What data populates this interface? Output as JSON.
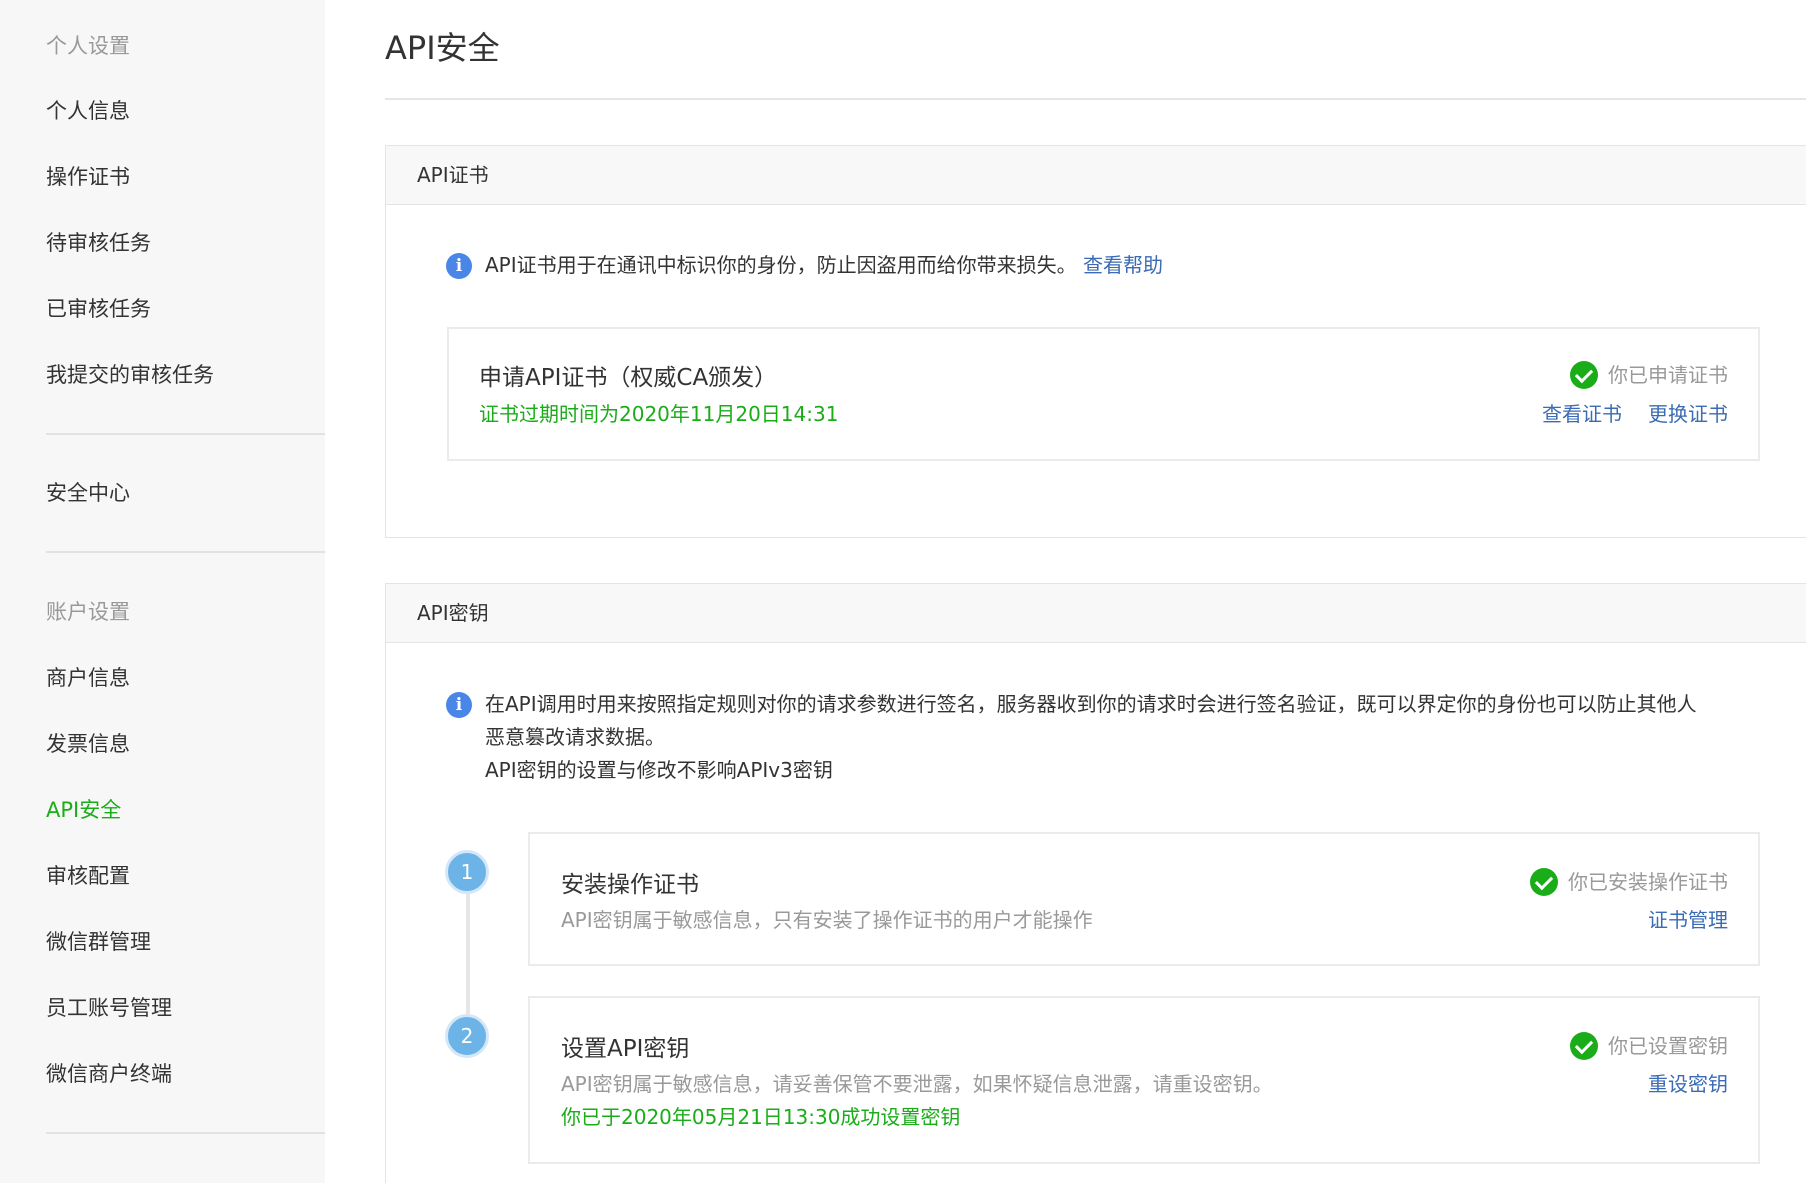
{
  "sidebar": {
    "section_personal": "个人设置",
    "items_personal": [
      "个人信息",
      "操作证书",
      "待审核任务",
      "已审核任务",
      "我提交的审核任务"
    ],
    "security_center": "安全中心",
    "section_account": "账户设置",
    "items_account": [
      "商户信息",
      "发票信息",
      "API安全",
      "审核配置",
      "微信群管理",
      "员工账号管理",
      "微信商户终端"
    ],
    "active_item": "API安全"
  },
  "page": {
    "title": "API安全"
  },
  "cert_panel": {
    "header": "API证书",
    "info": "API证书用于在通讯中标识你的身份，防止因盗用而给你带来损失。",
    "help_link": "查看帮助",
    "card": {
      "title": "申请API证书（权威CA颁发）",
      "expiry": "证书过期时间为2020年11月20日14:31",
      "status": "你已申请证书",
      "action_view": "查看证书",
      "action_replace": "更换证书"
    }
  },
  "key_panel": {
    "header": "API密钥",
    "info_line1": "在API调用时用来按照指定规则对你的请求参数进行签名，服务器收到你的请求时会进行签名验证，既可以界定你的身份也可以防止其他人",
    "info_line2": "恶意篡改请求数据。",
    "info_line3": "API密钥的设置与修改不影响APIv3密钥",
    "steps": [
      {
        "number": "1",
        "title": "安装操作证书",
        "desc": "API密钥属于敏感信息，只有安装了操作证书的用户才能操作",
        "status": "你已安装操作证书",
        "action": "证书管理"
      },
      {
        "number": "2",
        "title": "设置API密钥",
        "desc": "API密钥属于敏感信息，请妥善保管不要泄露，如果怀疑信息泄露，请重设密钥。",
        "note": "你已于2020年05月21日13:30成功设置密钥",
        "status": "你已设置密钥",
        "action": "重设密钥"
      }
    ]
  },
  "colors": {
    "accent_green": "#1aad19",
    "link_blue": "#3b6bb5",
    "info_blue": "#4a86e8",
    "step_blue": "#6cb3e8"
  },
  "icons": [
    "info-icon",
    "check-circle-icon"
  ]
}
